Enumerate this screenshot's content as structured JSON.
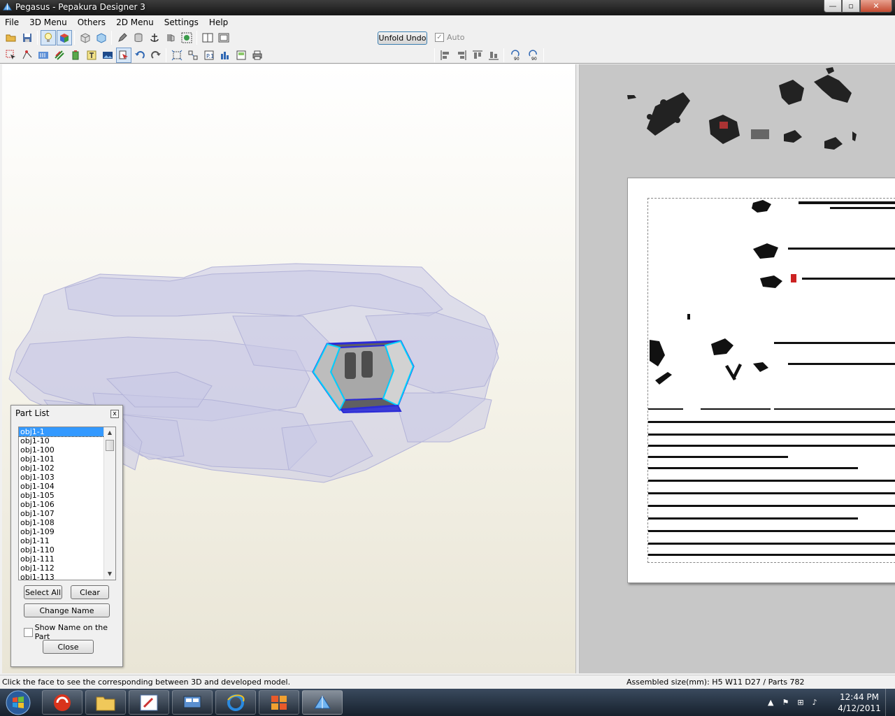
{
  "window": {
    "title": "Pegasus - Pepakura Designer 3",
    "controls": {
      "minimize": "—",
      "maximize": "▫",
      "close": "✕"
    }
  },
  "menu": [
    "File",
    "3D Menu",
    "Others",
    "2D Menu",
    "Settings",
    "Help"
  ],
  "toolbar": {
    "unfold_undo_label": "Unfold Undo",
    "auto_label": "Auto",
    "auto_checked": true,
    "rotate_left_label": "90",
    "rotate_right_label": "90"
  },
  "part_list": {
    "title": "Part List",
    "close_x": "x",
    "items": [
      "obj1-1",
      "obj1-10",
      "obj1-100",
      "obj1-101",
      "obj1-102",
      "obj1-103",
      "obj1-104",
      "obj1-105",
      "obj1-106",
      "obj1-107",
      "obj1-108",
      "obj1-109",
      "obj1-11",
      "obj1-110",
      "obj1-111",
      "obj1-112",
      "obj1-113"
    ],
    "selected": "obj1-1",
    "select_all_label": "Select All",
    "clear_label": "Clear",
    "change_name_label": "Change Name",
    "show_name_label": "Show Name on the Part",
    "show_name_checked": false,
    "close_label": "Close"
  },
  "status": {
    "left": "Click the face to see the corresponding between 3D and developed model.",
    "right": "Assembled size(mm): H5 W11 D27 / Parts 782"
  },
  "taskbar": {
    "time": "12:44 PM",
    "date": "4/12/2011"
  },
  "icons": {
    "app": "pepakura-icon",
    "start": "windows-start-icon"
  }
}
